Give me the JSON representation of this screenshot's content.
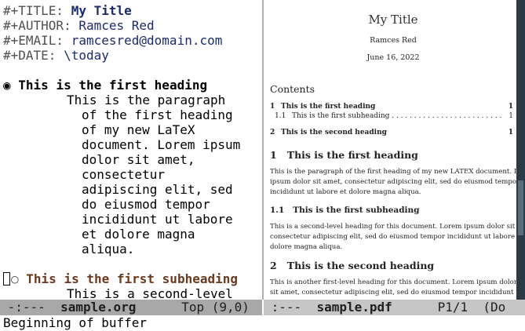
{
  "org": {
    "title_kw": "#+TITLE:",
    "title_val": "My Title",
    "author_kw": "#+AUTHOR:",
    "author_val": "Ramces Red",
    "email_kw": "#+EMAIL:",
    "email_val": "ramcesred@domain.com",
    "date_kw": "#+DATE:",
    "date_val": "\\today",
    "h1_bullet": "◉",
    "h1_text": "This is the first heading",
    "para_lines": [
      "This is the paragraph",
      "of the first heading",
      "of my new LaTeX",
      "document. Lorem ipsum",
      "dolor sit amet,",
      "consectetur",
      "adipiscing elit, sed",
      "do eiusmod tempor",
      "incididunt ut labore",
      "et dolore magna",
      "aliqua."
    ],
    "h2_bullet": "○",
    "h2_text": "This is the first subheading",
    "h2_para_first": "This is a second-level"
  },
  "pdf": {
    "title": "My Title",
    "author": "Ramces Red",
    "date": "June 16, 2022",
    "contents_heading": "Contents",
    "toc": [
      {
        "num": "1",
        "label": "This is the first heading",
        "page": "1"
      },
      {
        "num": "1.1",
        "label": "This is the first subheading . . . . . . . . . . . . . . . . . . . . . . . . .",
        "page": "1"
      },
      {
        "num": "2",
        "label": "This is the second heading",
        "page": "1"
      }
    ],
    "sec1_num": "1",
    "sec1_title": "This is the first heading",
    "sec1_lines": [
      "This is the paragraph of the first heading of my new LATEX document. Lorem",
      "ipsum dolor sit amet, consectetur adipiscing elit, sed do eiusmod tempor",
      "incididunt ut labore et dolore magna aliqua."
    ],
    "sub1_num": "1.1",
    "sub1_title": "This is the first subheading",
    "sub1_lines": [
      "This is a second-level heading for this document. Lorem ipsum dolor sit amet,",
      "consectetur adipiscing elit, sed do eiusmod tempor incididunt ut labore et",
      "dolore magna aliqua."
    ],
    "sec2_num": "2",
    "sec2_title": "This is the second heading",
    "sec2_lines": [
      "This is another first-level heading for this document. Lorem ipsum dolor",
      "sit amet, consectetur adipiscing elit, sed do eiusmod tempor incididunt ut"
    ]
  },
  "modeline_left": {
    "status": " -:---  ",
    "buffer": "sample.org",
    "position": "      Top (9,0)"
  },
  "modeline_right": {
    "status": " :---  ",
    "buffer": "sample.pdf",
    "position": "      P1/1  (Do"
  },
  "echo": "Beginning of buffer",
  "colors": {
    "title": "#1a2b6b",
    "subheading": "#6b3a1e",
    "modeline_active": "#a8a8a8",
    "modeline_inactive": "#c6c6c6"
  }
}
